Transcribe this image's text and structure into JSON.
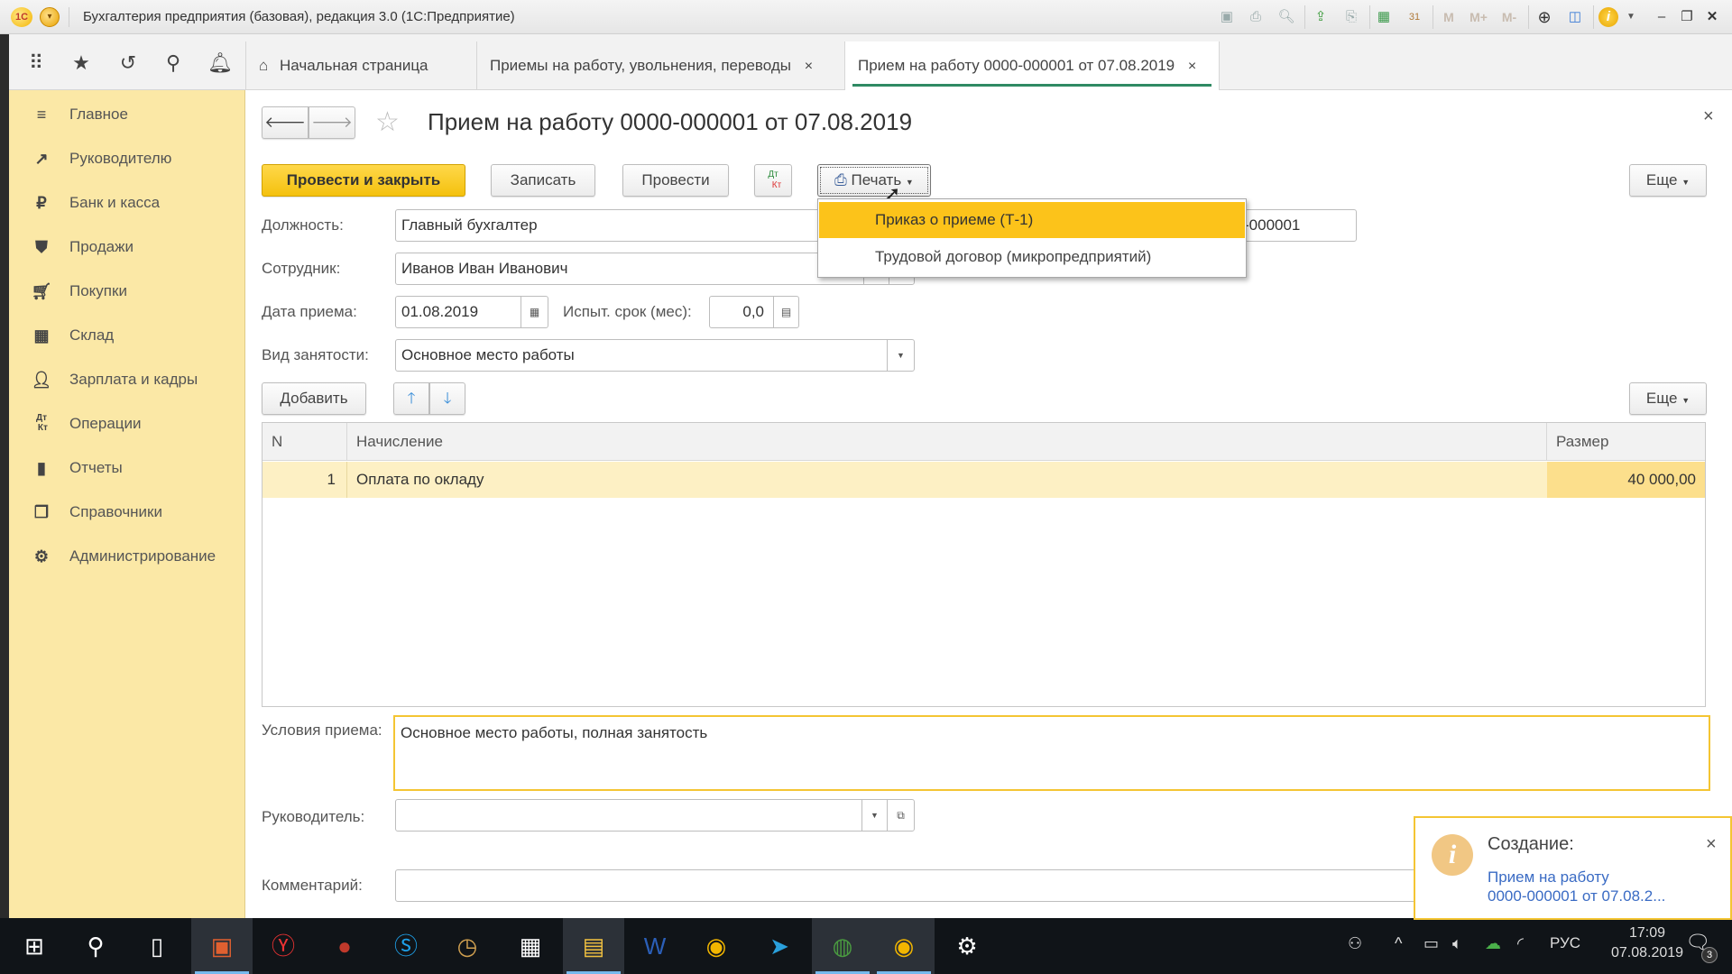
{
  "window": {
    "title": "Бухгалтерия предприятия (базовая), редакция 3.0  (1С:Предприятие)",
    "logo_text": "1С",
    "toolbar_icons": [
      "save-icon",
      "print-icon",
      "preview-icon",
      "upload-icon",
      "download-icon",
      "calculator-icon",
      "calendar-icon",
      "M",
      "M+",
      "M-",
      "zoom-in-icon",
      "panels-icon",
      "info-icon",
      "minimize-icon",
      "restore-icon",
      "close-icon"
    ],
    "calendar_day": "31",
    "mem_labels": [
      "M",
      "M+",
      "M-"
    ]
  },
  "nav": {
    "icons": [
      "apps-grid-icon",
      "favorites-star-icon",
      "history-icon",
      "search-icon",
      "notifications-bell-icon"
    ],
    "tabs": [
      {
        "label": "Начальная страница",
        "closable": false,
        "active": false
      },
      {
        "label": "Приемы на работу, увольнения, переводы",
        "closable": true,
        "active": false
      },
      {
        "label": "Прием на работу 0000-000001 от 07.08.2019",
        "closable": true,
        "active": true
      }
    ],
    "close_glyph": "×"
  },
  "sidebar": {
    "items": [
      {
        "label": "Главное",
        "icon": "menu-lines-icon"
      },
      {
        "label": "Руководителю",
        "icon": "trend-icon"
      },
      {
        "label": "Банк и касса",
        "icon": "ruble-icon"
      },
      {
        "label": "Продажи",
        "icon": "shopping-bag-icon"
      },
      {
        "label": "Покупки",
        "icon": "cart-icon"
      },
      {
        "label": "Склад",
        "icon": "warehouse-icon"
      },
      {
        "label": "Зарплата и кадры",
        "icon": "person-icon"
      },
      {
        "label": "Операции",
        "icon": "dt-kt-icon"
      },
      {
        "label": "Отчеты",
        "icon": "bar-chart-icon"
      },
      {
        "label": "Справочники",
        "icon": "books-icon"
      },
      {
        "label": "Администрирование",
        "icon": "gear-icon"
      }
    ]
  },
  "document": {
    "title": "Прием на работу 0000-000001 от 07.08.2019",
    "toolbar": {
      "post_close": "Провести и закрыть",
      "save": "Записать",
      "post": "Провести",
      "dtkt_top": "Дт",
      "dtkt_bottom": "Кт",
      "print": "Печать",
      "more": "Еще"
    },
    "print_menu": [
      {
        "label": "Приказ о приеме (Т-1)",
        "highlighted": true
      },
      {
        "label": "Трудовой договор (микропредприятий)",
        "highlighted": false
      }
    ],
    "fields": {
      "position_label": "Должность:",
      "position_value": "Главный бухгалтер",
      "number_value_visible": "-000001",
      "employee_label": "Сотрудник:",
      "employee_value": "Иванов Иван Иванович",
      "hire_date_label": "Дата приема:",
      "hire_date_value": "01.08.2019",
      "probation_label": "Испыт. срок (мес):",
      "probation_value": "0,0",
      "employment_type_label": "Вид занятости:",
      "employment_type_value": "Основное место работы",
      "conditions_label": "Условия приема:",
      "conditions_value": "Основное место работы, полная занятость",
      "manager_label": "Руководитель:",
      "manager_value": "",
      "comment_label": "Комментарий:",
      "comment_value": ""
    },
    "table_toolbar": {
      "add": "Добавить",
      "more": "Еще"
    },
    "table": {
      "columns": [
        "N",
        "Начисление",
        "Размер"
      ],
      "rows": [
        {
          "n": "1",
          "accrual": "Оплата по окладу",
          "amount": "40 000,00"
        }
      ]
    }
  },
  "notification": {
    "title": "Создание:",
    "link_line1": "Прием на работу",
    "link_line2": "0000-000001 от 07.08.2...",
    "close_glyph": "×"
  },
  "taskbar": {
    "apps": [
      "start-icon",
      "search-icon",
      "task-view-icon",
      "presentation-app-icon",
      "yandex-browser-icon",
      "apple-app-icon",
      "skype-icon",
      "clock-app-icon",
      "calculator-app-icon",
      "file-explorer-icon",
      "word-icon",
      "1c-icon",
      "telegram-icon",
      "chrome-icon",
      "1c-active-icon",
      "settings-icon"
    ],
    "tray": {
      "language": "РУС",
      "time": "17:09",
      "date": "07.08.2019",
      "notifications_count": "3"
    }
  },
  "colors": {
    "accent_yellow": "#fcc31a",
    "sidebar_bg": "#fbe8a6",
    "active_tab_underline": "#2f8a63",
    "link_blue": "#3a6bc4"
  }
}
